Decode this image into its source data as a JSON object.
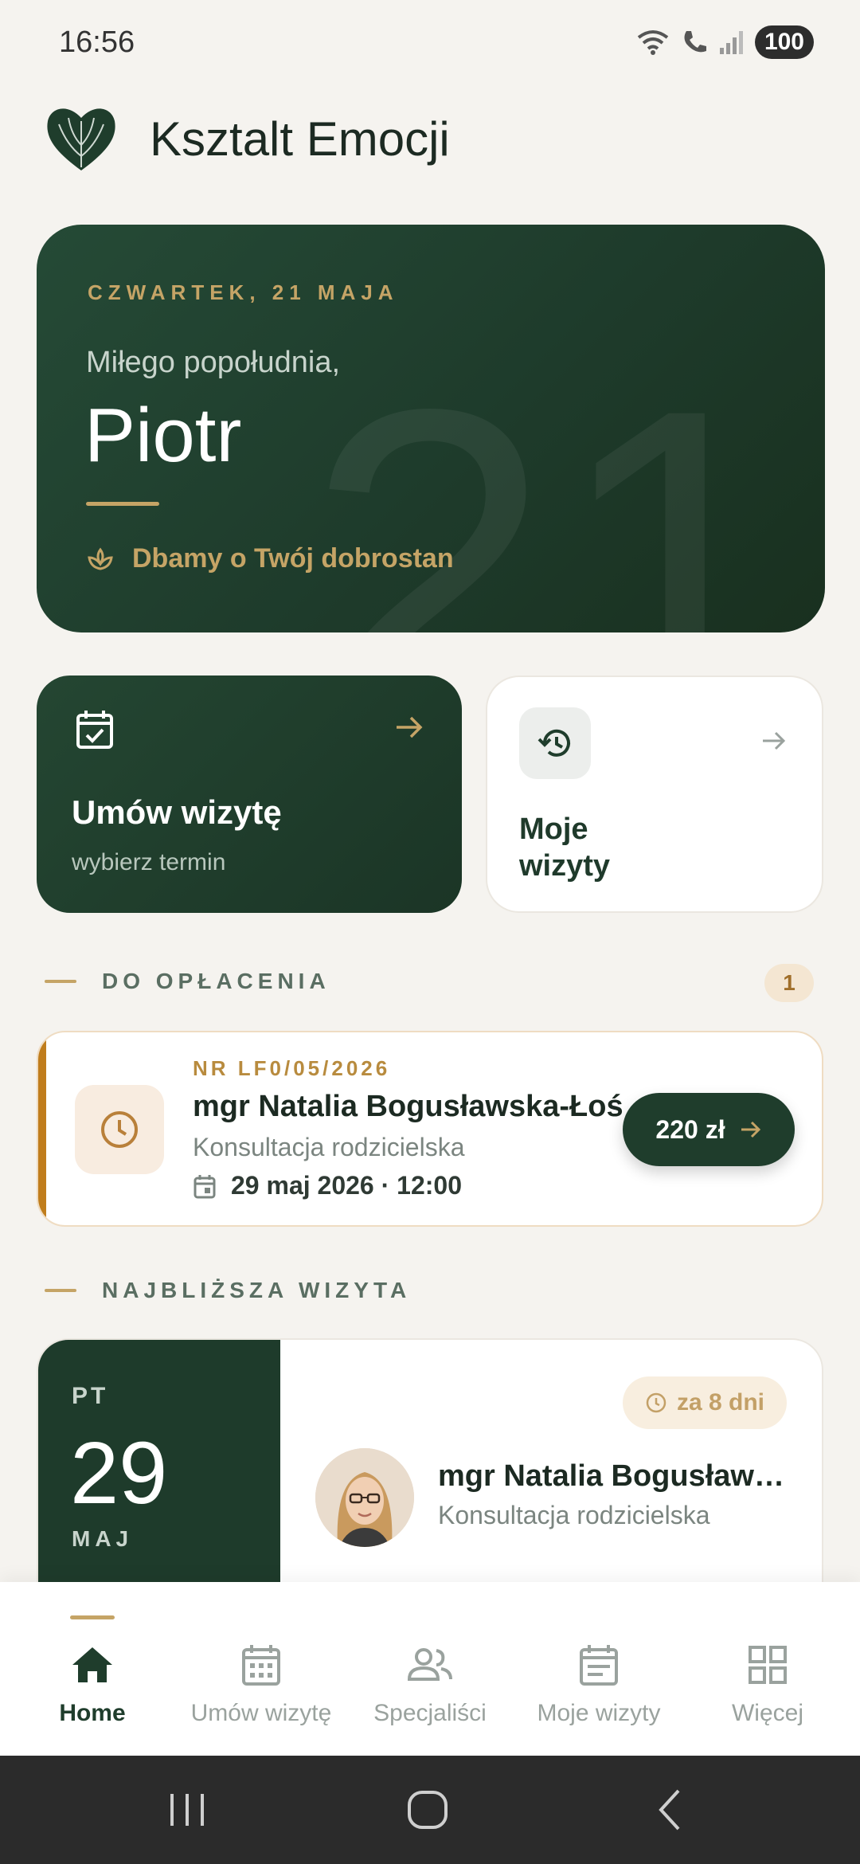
{
  "status_bar": {
    "time": "16:56",
    "battery": "100"
  },
  "app": {
    "title": "Ksztalt Emocji"
  },
  "hero": {
    "date_label": "CZWARTEK, 21 MAJA",
    "greeting": "Miłego popołudnia,",
    "name": "Piotr",
    "big_number": "21",
    "tagline": "Dbamy o Twój dobrostan"
  },
  "quick_actions": {
    "book": {
      "title": "Umów wizytę",
      "subtitle": "wybierz termin"
    },
    "visits": {
      "title": "Moje wizyty"
    }
  },
  "to_pay": {
    "section_title": "DO OPŁACENIA",
    "count": "1",
    "invoice_number": "NR LF0/05/2026",
    "doctor": "mgr Natalia Bogusławska-Łoś",
    "service": "Konsultacja rodzicielska",
    "datetime": "29 maj 2026 · 12:00",
    "amount": "220 zł"
  },
  "next_visit": {
    "section_title": "NAJBLIŻSZA WIZYTA",
    "day_of_week": "PT",
    "day": "29",
    "month": "MAJ",
    "countdown": "za 8 dni",
    "doctor": "mgr Natalia Bogusławska-Łoś",
    "service": "Konsultacja rodzicielska"
  },
  "bottom_nav": {
    "items": [
      {
        "label": "Home",
        "icon": "home-icon",
        "active": true
      },
      {
        "label": "Umów wizytę",
        "icon": "calendar-grid-icon",
        "active": false
      },
      {
        "label": "Specjaliści",
        "icon": "people-icon",
        "active": false
      },
      {
        "label": "Moje wizyty",
        "icon": "calendar-list-icon",
        "active": false
      },
      {
        "label": "Więcej",
        "icon": "grid-icon",
        "active": false
      }
    ]
  },
  "colors": {
    "primary": "#1f3d2c",
    "accent_gold": "#c5a466",
    "warning": "#c07d1c",
    "background": "#f5f3ef"
  }
}
